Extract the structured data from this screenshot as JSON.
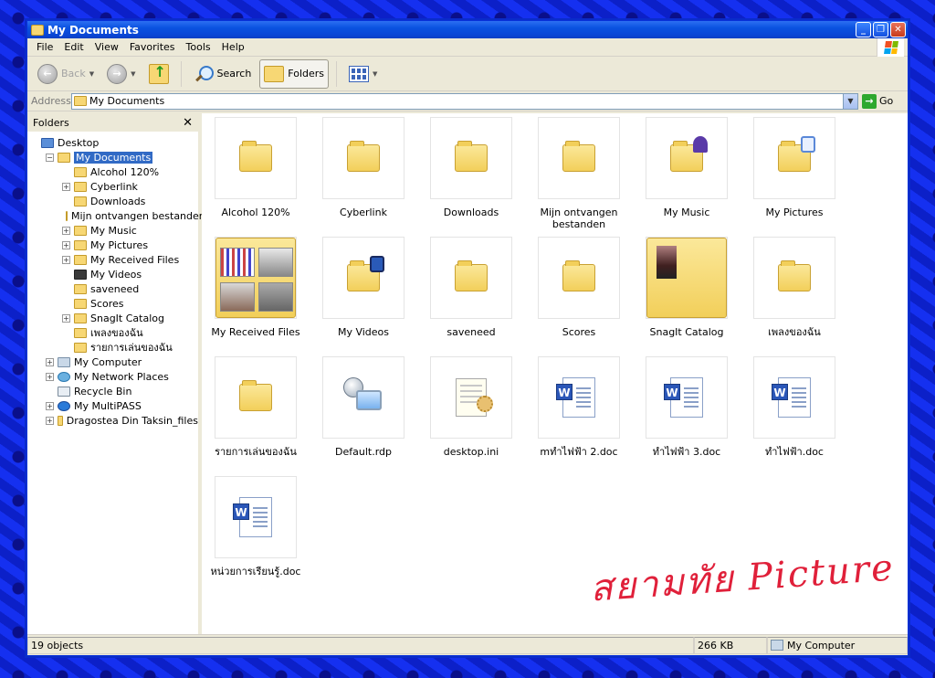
{
  "window": {
    "title": "My Documents",
    "controls": [
      "minimize",
      "maximize",
      "close"
    ]
  },
  "menu": [
    "File",
    "Edit",
    "View",
    "Favorites",
    "Tools",
    "Help"
  ],
  "toolbar": {
    "back_label": "Back",
    "search_label": "Search",
    "folders_label": "Folders"
  },
  "address": {
    "label": "Address",
    "value": "My Documents",
    "go_label": "Go"
  },
  "folders_pane": {
    "title": "Folders",
    "close_glyph": "✕",
    "tree": [
      {
        "label": "Desktop",
        "level": 0,
        "expander": "",
        "icon": "desktop-icon"
      },
      {
        "label": "My Documents",
        "level": 1,
        "expander": "−",
        "icon": "my-documents-icon",
        "selected": true
      },
      {
        "label": "Alcohol 120%",
        "level": 2,
        "expander": "",
        "icon": "folder-icon"
      },
      {
        "label": "Cyberlink",
        "level": 2,
        "expander": "+",
        "icon": "folder-icon"
      },
      {
        "label": "Downloads",
        "level": 2,
        "expander": "",
        "icon": "folder-icon"
      },
      {
        "label": "Mijn ontvangen bestanden",
        "level": 2,
        "expander": "",
        "icon": "folder-icon"
      },
      {
        "label": "My Music",
        "level": 2,
        "expander": "+",
        "icon": "music-folder-icon"
      },
      {
        "label": "My Pictures",
        "level": 2,
        "expander": "+",
        "icon": "pictures-folder-icon"
      },
      {
        "label": "My Received Files",
        "level": 2,
        "expander": "+",
        "icon": "folder-icon"
      },
      {
        "label": "My Videos",
        "level": 2,
        "expander": "",
        "icon": "videos-folder-icon"
      },
      {
        "label": "saveneed",
        "level": 2,
        "expander": "",
        "icon": "folder-icon"
      },
      {
        "label": "Scores",
        "level": 2,
        "expander": "",
        "icon": "folder-icon"
      },
      {
        "label": "SnagIt Catalog",
        "level": 2,
        "expander": "+",
        "icon": "folder-icon"
      },
      {
        "label": "เพลงของฉัน",
        "level": 2,
        "expander": "",
        "icon": "folder-icon"
      },
      {
        "label": "รายการเล่นของฉัน",
        "level": 2,
        "expander": "",
        "icon": "folder-icon"
      },
      {
        "label": "My Computer",
        "level": 1,
        "expander": "+",
        "icon": "my-computer-icon"
      },
      {
        "label": "My Network Places",
        "level": 1,
        "expander": "+",
        "icon": "network-places-icon"
      },
      {
        "label": "Recycle Bin",
        "level": 1,
        "expander": "",
        "icon": "recycle-bin-icon"
      },
      {
        "label": "My MultiPASS",
        "level": 1,
        "expander": "+",
        "icon": "multipass-icon"
      },
      {
        "label": "Dragostea Din Taksin_files",
        "level": 1,
        "expander": "+",
        "icon": "folder-icon"
      }
    ]
  },
  "files": [
    {
      "name": "Alcohol 120%",
      "kind": "folder"
    },
    {
      "name": "Cyberlink",
      "kind": "folder"
    },
    {
      "name": "Downloads",
      "kind": "folder"
    },
    {
      "name": "Mijn ontvangen bestanden",
      "kind": "folder"
    },
    {
      "name": "My Music",
      "kind": "music-folder"
    },
    {
      "name": "My Pictures",
      "kind": "pictures-folder"
    },
    {
      "name": "My Received Files",
      "kind": "thumbnail-folder"
    },
    {
      "name": "My Videos",
      "kind": "videos-folder"
    },
    {
      "name": "saveneed",
      "kind": "folder"
    },
    {
      "name": "Scores",
      "kind": "folder"
    },
    {
      "name": "SnagIt Catalog",
      "kind": "preview-folder"
    },
    {
      "name": "เพลงของฉัน",
      "kind": "folder"
    },
    {
      "name": "รายการเล่นของฉัน",
      "kind": "folder"
    },
    {
      "name": "Default.rdp",
      "kind": "rdp"
    },
    {
      "name": "desktop.ini",
      "kind": "ini"
    },
    {
      "name": "mทำไฟฟ้า 2.doc",
      "kind": "doc"
    },
    {
      "name": "ทำไฟฟ้า 3.doc",
      "kind": "doc"
    },
    {
      "name": "ทำไฟฟ้า.doc",
      "kind": "doc"
    },
    {
      "name": "หน่วยการเรียนรู้.doc",
      "kind": "doc"
    }
  ],
  "status": {
    "objects": "19 objects",
    "size": "266 KB",
    "location": "My Computer"
  },
  "watermark": {
    "text": "สยามทัย Picture",
    "color": "#e0203a"
  }
}
